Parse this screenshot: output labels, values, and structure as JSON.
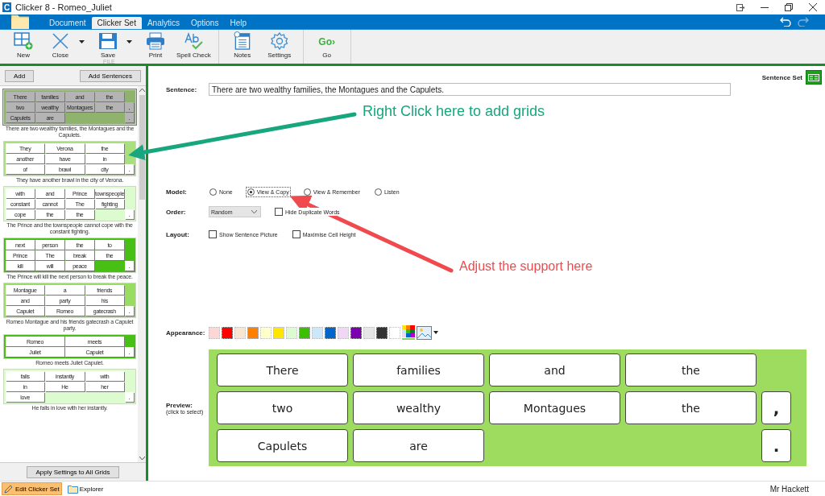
{
  "window": {
    "app_icon": "C",
    "title": "Clicker 8 - Romeo_Juliet"
  },
  "ribbon": {
    "tabs": [
      {
        "label": "Document",
        "selected": false
      },
      {
        "label": "Clicker Set",
        "selected": true
      },
      {
        "label": "Analytics",
        "selected": false
      },
      {
        "label": "Options",
        "selected": false
      },
      {
        "label": "Help",
        "selected": false
      }
    ],
    "groups": [
      {
        "label": "FILE",
        "items": [
          {
            "label": "New",
            "kind": "new",
            "dropdown": false
          },
          {
            "label": "Close",
            "kind": "close",
            "dropdown": true
          },
          {
            "label": "Save",
            "kind": "save",
            "dropdown": true
          },
          {
            "label": "Print",
            "kind": "print",
            "dropdown": false
          },
          {
            "label": "Spell Check",
            "kind": "spell",
            "dropdown": false
          }
        ]
      },
      {
        "items": [
          {
            "label": "Notes",
            "kind": "notes",
            "dropdown": false
          },
          {
            "label": "Settings",
            "kind": "settings",
            "dropdown": false
          }
        ]
      },
      {
        "items": [
          {
            "label": "Go",
            "kind": "go",
            "icon_text": "Go›",
            "dropdown": false
          }
        ]
      }
    ]
  },
  "sidebar": {
    "buttons": [
      "Add",
      "Add Sentences"
    ],
    "grids": [
      {
        "selected": true,
        "color": "#8fb36c",
        "rows": [
          {
            "words": [
              "There",
              "families",
              "and",
              "the"
            ]
          },
          {
            "words": [
              "two",
              "wealthy",
              "Montagues",
              "the"
            ],
            "mark": ","
          },
          {
            "words": [
              "Capulets",
              "are"
            ],
            "mark": "."
          }
        ],
        "caption": "There are two wealthy families, the Montagues and the Capulets."
      },
      {
        "selected": false,
        "color": "#a8e07e",
        "rows": [
          {
            "words": [
              "They",
              "Verona",
              "the"
            ]
          },
          {
            "words": [
              "another",
              "have",
              "in"
            ]
          },
          {
            "words": [
              "of",
              "brawl",
              "city"
            ],
            "mark": "."
          }
        ],
        "caption": "They have another brawl in the city of Verona."
      },
      {
        "selected": false,
        "color": "#dcfbcf",
        "rows": [
          {
            "words": [
              "with",
              "and",
              "Prince",
              "townspeople"
            ]
          },
          {
            "words": [
              "constant",
              "cannot",
              "The",
              "fighting"
            ]
          },
          {
            "words": [
              "cope",
              "the",
              "the"
            ],
            "mark": "."
          }
        ],
        "caption": "The Prince and the townspeople cannot cope with the constant fighting."
      },
      {
        "selected": false,
        "color": "#48bf14",
        "rows": [
          {
            "words": [
              "next",
              "person",
              "the",
              "to"
            ]
          },
          {
            "words": [
              "Prince",
              "The",
              "break",
              "the"
            ]
          },
          {
            "words": [
              "kill",
              "will",
              "peace"
            ],
            "mark": "."
          }
        ],
        "caption": "The Prince will kill the next person to break the peace."
      },
      {
        "selected": false,
        "color": "#98dc62",
        "rows": [
          {
            "words": [
              "Montague",
              "a",
              "friends"
            ]
          },
          {
            "words": [
              "and",
              "party",
              "his"
            ]
          },
          {
            "words": [
              "Capulet",
              "Romeo",
              "gatecrash"
            ],
            "mark": "."
          }
        ],
        "caption": "Romeo Montague and his friends gatecrash a Capulet party."
      },
      {
        "selected": false,
        "color": "#48bf14",
        "rows": [
          {
            "words": [
              "Romeo",
              "meets"
            ]
          },
          {
            "words": [
              "Juliet",
              "Capulet"
            ],
            "mark": "."
          }
        ],
        "caption": "Romeo meets Juliet Capulet."
      },
      {
        "selected": false,
        "color": "#dcfbcf",
        "rows": [
          {
            "words": [
              "falls",
              "instantly",
              "with"
            ]
          },
          {
            "words": [
              "in",
              "He",
              "her"
            ]
          },
          {
            "words": [
              "love"
            ],
            "mark": "."
          }
        ],
        "caption": "He falls in love with her instantly."
      }
    ],
    "apply_button": "Apply Settings to All Grids"
  },
  "sentence_set": {
    "label": "Sentence Set"
  },
  "form": {
    "sentence": {
      "label": "Sentence:",
      "value": "There are two wealthy families, the Montagues and the Capulets."
    },
    "model": {
      "label": "Model:",
      "options": [
        {
          "label": "None",
          "selected": false
        },
        {
          "label": "View & Copy",
          "selected": true
        },
        {
          "label": "View & Remember",
          "selected": false
        },
        {
          "label": "Listen",
          "selected": false
        }
      ]
    },
    "order": {
      "label": "Order:",
      "value": "Random",
      "checkbox": {
        "label": "Hide Duplicate Words",
        "checked": false
      }
    },
    "layout": {
      "label": "Layout:",
      "checkboxes": [
        {
          "label": "Show Sentence Picture",
          "checked": false
        },
        {
          "label": "Maximise Cell Height",
          "checked": false
        }
      ]
    },
    "appearance": {
      "label": "Appearance:",
      "swatches": [
        {
          "color": "#ffd6d6"
        },
        {
          "color": "#ff0000"
        },
        {
          "color": "#f7e6d2"
        },
        {
          "color": "#ff8000"
        },
        {
          "color": "#ffffcc"
        },
        {
          "color": "#ffe600"
        },
        {
          "color": "#dcfbd0"
        },
        {
          "color": "#3cbf00"
        },
        {
          "color": "#cce6fa"
        },
        {
          "color": "#0066cc"
        },
        {
          "color": "#f0d8f5"
        },
        {
          "color": "#7a00b0"
        },
        {
          "color": "#e6e6e6"
        },
        {
          "color": "#333333"
        },
        {
          "color": "#ffffff"
        }
      ]
    }
  },
  "preview": {
    "label": "Preview:",
    "hint": "(click to select)",
    "color": "#9ddc5f",
    "rows": [
      {
        "words": [
          "There",
          "families",
          "and",
          "the"
        ]
      },
      {
        "words": [
          "two",
          "wealthy",
          "Montagues",
          "the"
        ],
        "mark": ","
      },
      {
        "words": [
          "Capulets",
          "are"
        ],
        "mark": "."
      }
    ]
  },
  "annotations": [
    {
      "text": "Right Click here to add grids",
      "color": "#17a67e"
    },
    {
      "text": "Adjust the support here",
      "color": "#f04a4e"
    }
  ],
  "status_bar": {
    "buttons": [
      {
        "label": "Edit Clicker Set",
        "selected": true,
        "kind": "pencil"
      },
      {
        "label": "Explorer",
        "selected": false,
        "kind": "folder"
      }
    ],
    "user": "Mr Hackett"
  }
}
